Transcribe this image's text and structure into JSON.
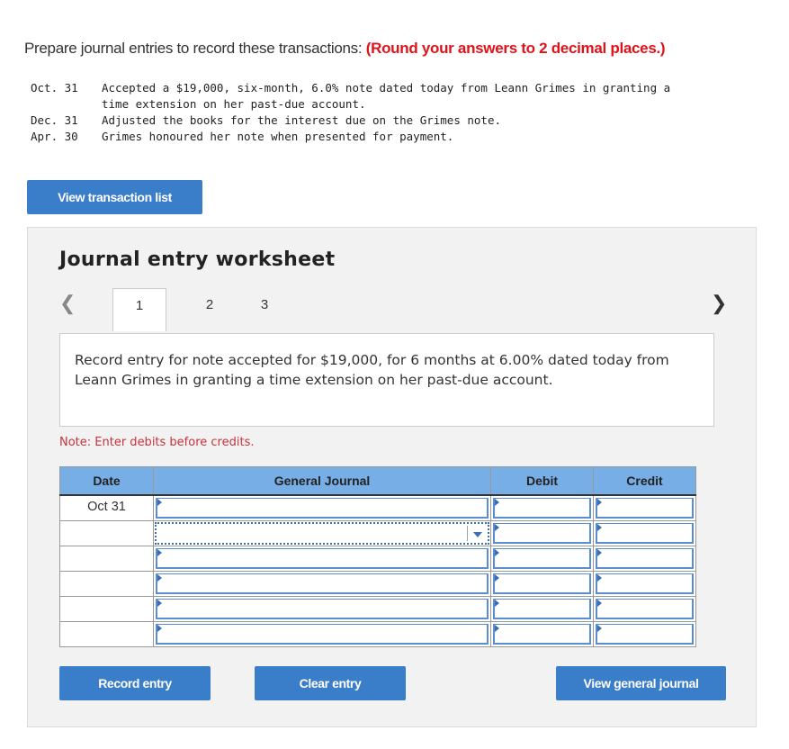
{
  "instructions": {
    "text": "Prepare journal entries to record these transactions:",
    "emphasis": "(Round your answers to 2 decimal places.)"
  },
  "transactions": [
    {
      "date": "Oct. 31",
      "text": "Accepted a $19,000, six-month, 6.0% note dated today from Leann Grimes in granting a",
      "text2": "time extension on her past-due account."
    },
    {
      "date": "Dec. 31",
      "text": "Adjusted the books for the interest due on the Grimes note."
    },
    {
      "date": "Apr. 30",
      "text": "Grimes honoured her note when presented for payment."
    }
  ],
  "view_transactions_label": "View transaction list",
  "worksheet": {
    "title": "Journal entry worksheet",
    "tabs": [
      "1",
      "2",
      "3"
    ],
    "description": "Record entry for note accepted for $19,000, for 6 months at 6.00% dated today from Leann Grimes in granting a time extension on her past-due account.",
    "note": "Note: Enter debits before credits.",
    "columns": [
      "Date",
      "General Journal",
      "Debit",
      "Credit"
    ],
    "rows": [
      {
        "date": "Oct 31"
      },
      {
        "date": ""
      },
      {
        "date": ""
      },
      {
        "date": ""
      },
      {
        "date": ""
      },
      {
        "date": ""
      }
    ],
    "buttons": {
      "record": "Record entry",
      "clear": "Clear entry",
      "view_journal": "View general journal"
    }
  },
  "colors": {
    "accent": "#3a7dc9",
    "header": "#77aee6",
    "emphasis": "#e0131a"
  }
}
